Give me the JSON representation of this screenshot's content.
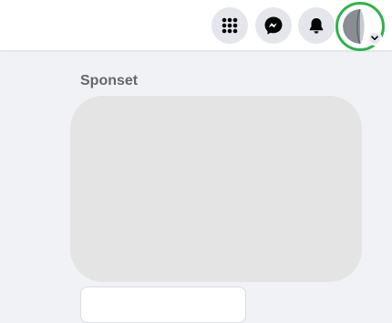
{
  "topbar": {
    "icons": {
      "menu": "menu-grid-icon",
      "messenger": "messenger-icon",
      "notifications": "bell-icon",
      "account": "avatar",
      "account_badge": "chevron-down-icon"
    }
  },
  "sidebar": {
    "sponsored_title": "Sponset"
  },
  "colors": {
    "page_background": "#f0f2f5",
    "topbar_background": "#ffffff",
    "icon_button_background": "#e4e6eb",
    "highlight_ring": "#2db24a",
    "placeholder_card": "#e4e4e4",
    "heading_text": "#65676b"
  }
}
